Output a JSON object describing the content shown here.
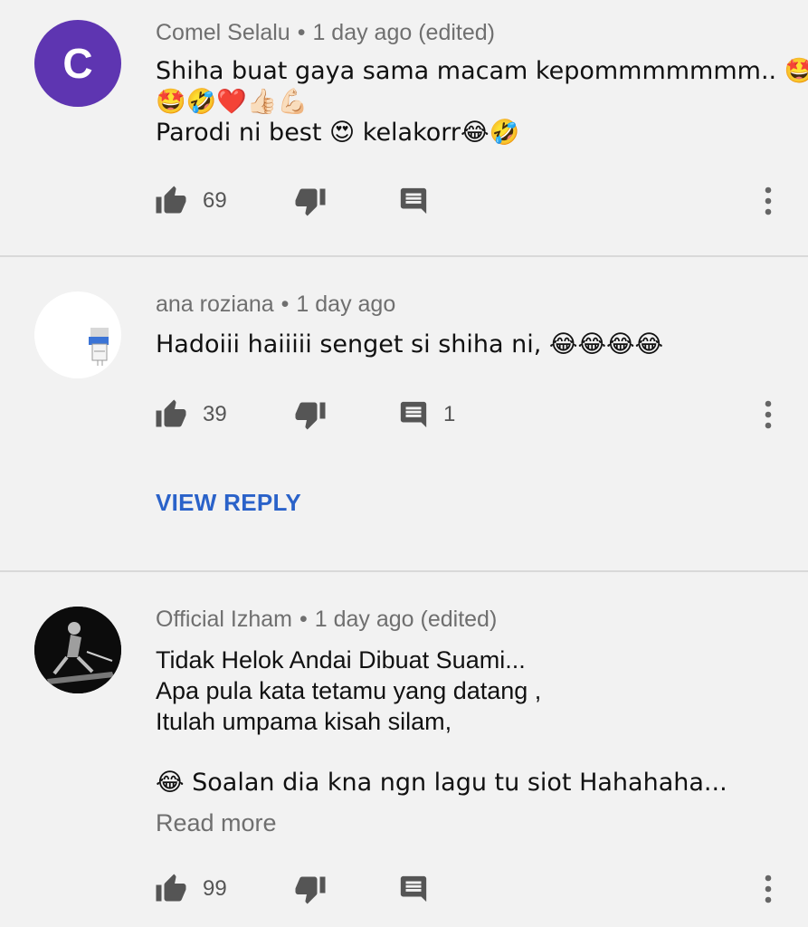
{
  "comments": [
    {
      "author": "Comel Selalu",
      "avatar_letter": "C",
      "time": "1 day ago (edited)",
      "lines": [
        "Shiha buat gaya sama macam kepommmmmmm.. 🤩",
        "🤩🤣❤️👍🏻💪🏻",
        "Parodi ni best 😍 kelakorr😂🤣"
      ],
      "likes": "69",
      "replies": ""
    },
    {
      "author": "ana roziana",
      "time": "1 day ago",
      "lines": [
        "Hadoiii haiiiii senget si shiha ni, 😂😂😂😂"
      ],
      "likes": "39",
      "replies": "1",
      "view_reply": "VIEW REPLY"
    },
    {
      "author": "Official Izham",
      "time": "1 day ago (edited)",
      "lines": [
        "Tidak Helok Andai Dibuat Suami...",
        "Apa pula kata tetamu yang datang ,",
        "Itulah umpama kisah silam,",
        "",
        "😂 Soalan dia kna ngn lagu tu siot Hahahaha..."
      ],
      "read_more": "Read more",
      "likes": "99",
      "replies": ""
    }
  ],
  "colors": {
    "background": "#f2f2f2",
    "avatar_purple": "#5e35b1",
    "link_blue": "#2a62c9",
    "meta_gray": "#6f6f6f"
  },
  "icons": [
    "thumb-up-icon",
    "thumb-down-icon",
    "comment-icon",
    "more-vert-icon"
  ]
}
